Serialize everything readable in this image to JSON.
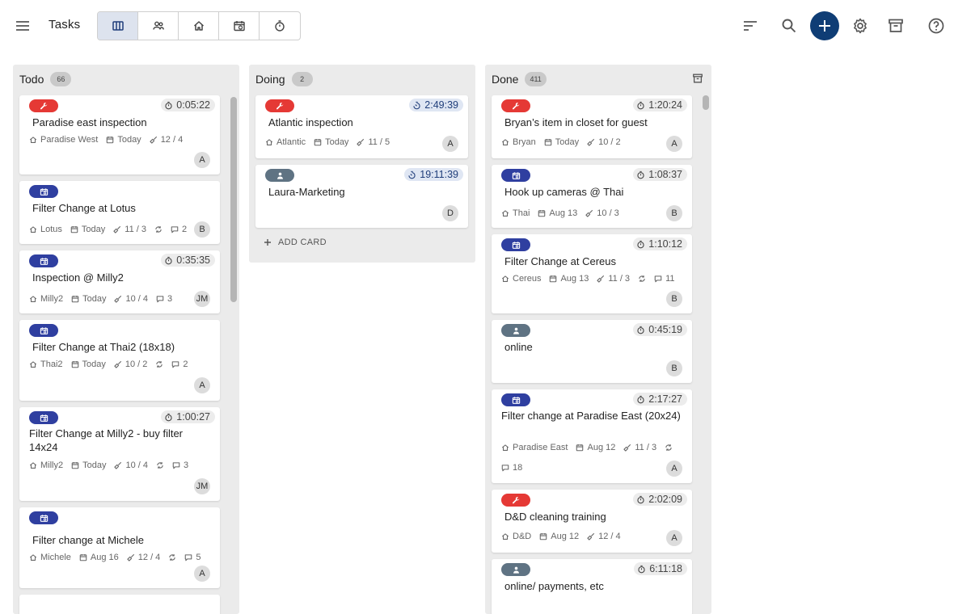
{
  "header": {
    "title": "Tasks",
    "views": [
      {
        "icon": "board-view-icon",
        "active": true
      },
      {
        "icon": "people-view-icon",
        "active": false
      },
      {
        "icon": "home-view-icon",
        "active": false
      },
      {
        "icon": "calendar-view-icon",
        "active": false
      },
      {
        "icon": "timer-view-icon",
        "active": false
      }
    ],
    "actions": [
      "sort-icon",
      "search-icon",
      "add-icon",
      "settings-icon",
      "archive-icon",
      "help-icon"
    ],
    "accent_color": "#0f3d75"
  },
  "columns": [
    {
      "title": "Todo",
      "count": "66",
      "cards": [
        {
          "badge": "repair",
          "timer": "0:05:22",
          "title": "Paradise east inspection",
          "location": "Paradise West",
          "date": "Today",
          "checks": "12 / 4",
          "avatar": "A"
        },
        {
          "badge": "schedule",
          "title": "Filter Change at Lotus",
          "location": "Lotus",
          "date": "Today",
          "checks": "11 / 3",
          "recurring": true,
          "comments": "2",
          "avatar": "B"
        },
        {
          "badge": "schedule",
          "timer": "0:35:35",
          "title": "Inspection @ Milly2",
          "location": "Milly2",
          "date": "Today",
          "checks": "10 / 4",
          "comments": "3",
          "avatar": "JM"
        },
        {
          "badge": "schedule",
          "title": "Filter Change at Thai2 (18x18)",
          "location": "Thai2",
          "date": "Today",
          "checks": "10 / 2",
          "recurring": true,
          "comments": "2",
          "avatar": "A"
        },
        {
          "badge": "schedule",
          "timer": "1:00:27",
          "title": "Filter Change at  Milly2 - buy filter 14x24",
          "location": "Milly2",
          "date": "Today",
          "checks": "10 / 4",
          "recurring": true,
          "comments": "3",
          "avatar": "JM"
        },
        {
          "badge": "schedule",
          "title": "Filter change at Michele",
          "location": "Michele",
          "date": "Aug 16",
          "checks": "12 / 4",
          "recurring": true,
          "comments": "5",
          "avatar": "A"
        }
      ]
    },
    {
      "title": "Doing",
      "count": "2",
      "add_label": "ADD CARD",
      "cards": [
        {
          "badge": "repair",
          "timer": "2:49:39",
          "running": true,
          "title": "Atlantic inspection",
          "location": "Atlantic",
          "date": "Today",
          "checks": "11 / 5",
          "avatar": "A"
        },
        {
          "badge": "person",
          "timer": "19:11:39",
          "running": true,
          "title": "Laura-Marketing",
          "avatar": "D"
        }
      ]
    },
    {
      "title": "Done",
      "count": "411",
      "cards": [
        {
          "badge": "repair",
          "timer": "1:20:24",
          "title": "Bryan’s item in closet for guest",
          "location": "Bryan",
          "date": "Today",
          "checks": "10 / 2",
          "avatar": "A"
        },
        {
          "badge": "schedule",
          "timer": "1:08:37",
          "title": "Hook up cameras @ Thai",
          "location": "Thai",
          "date": "Aug 13",
          "checks": "10 / 3",
          "avatar": "B"
        },
        {
          "badge": "schedule",
          "timer": "1:10:12",
          "title": "Filter Change at Cereus",
          "location": "Cereus",
          "date": "Aug 13",
          "checks": "11 / 3",
          "recurring": true,
          "comments": "11",
          "avatar": "B"
        },
        {
          "badge": "person",
          "timer": "0:45:19",
          "title": "online",
          "avatar": "B"
        },
        {
          "badge": "schedule",
          "timer": "2:17:27",
          "title": "Filter change at Paradise East (20x24)",
          "location": "Paradise East",
          "date": "Aug 12",
          "checks": "11 / 3",
          "recurring": true,
          "comments": "18",
          "avatar": "A"
        },
        {
          "badge": "repair",
          "timer": "2:02:09",
          "title": "D&D cleaning training",
          "location": "D&D",
          "date": "Aug 12",
          "checks": "12 / 4",
          "avatar": "A"
        },
        {
          "badge": "person",
          "timer": "6:11:18",
          "title": "online/ payments, etc"
        }
      ]
    }
  ],
  "colors": {
    "repair": "#e53935",
    "schedule": "#2f3fa0",
    "person": "#5f7383"
  }
}
